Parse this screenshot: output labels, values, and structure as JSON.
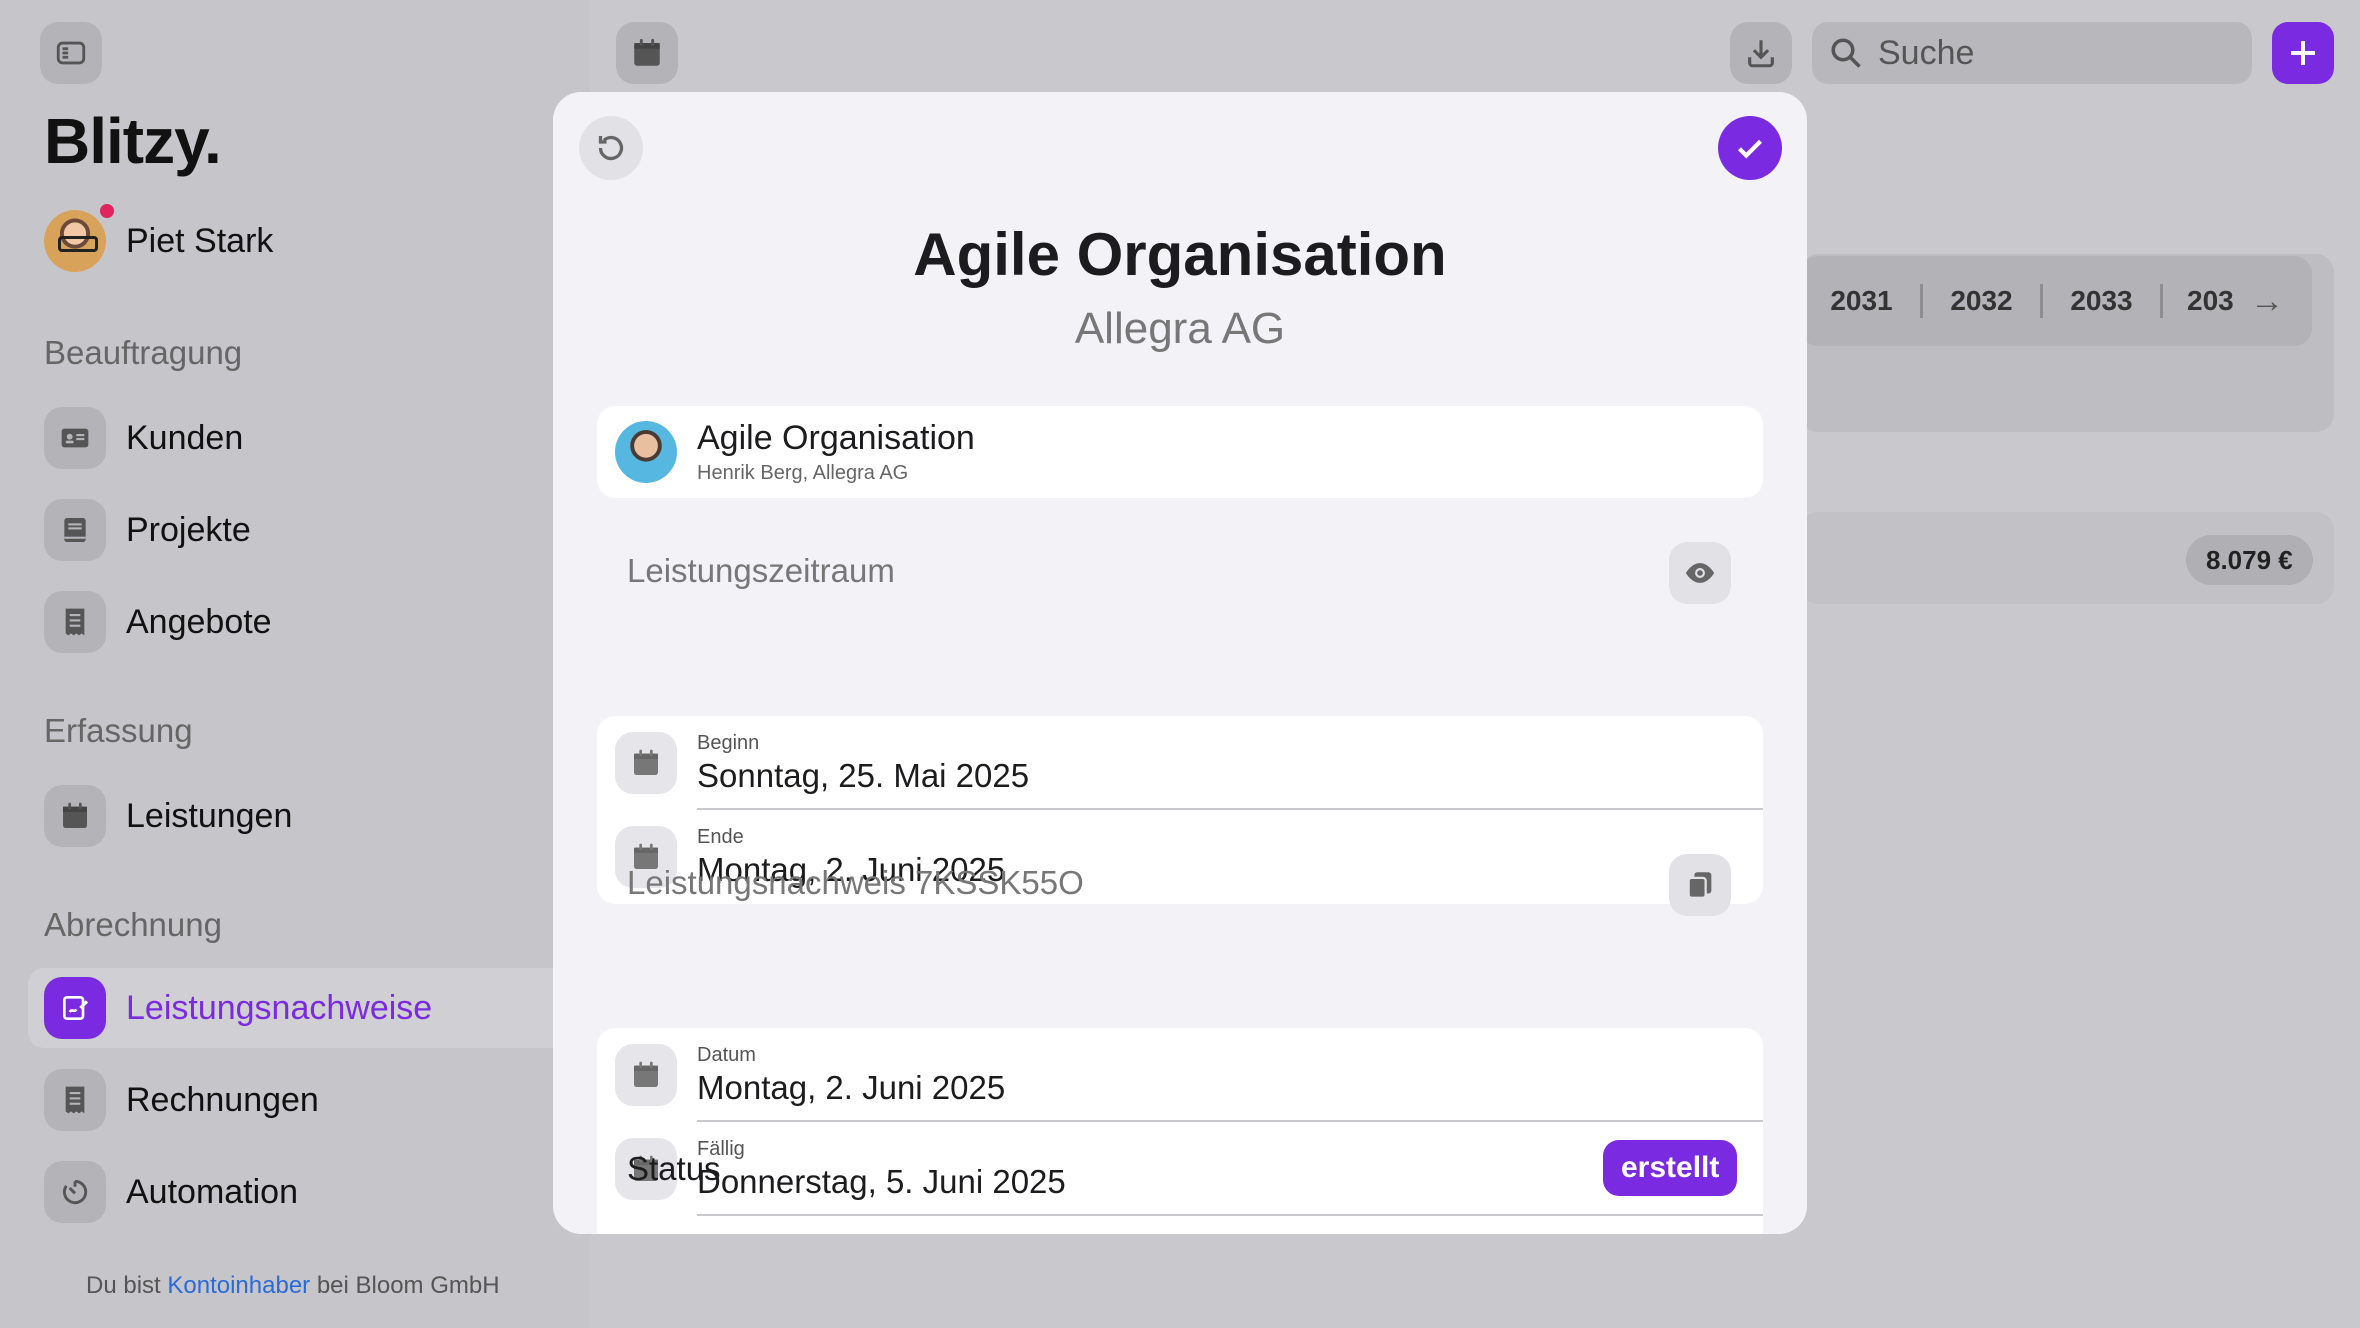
{
  "app": {
    "brand": "Blitzy."
  },
  "user": {
    "name": "Piet Stark"
  },
  "sidebar": {
    "sections": [
      {
        "title": "Beauftragung",
        "items": [
          {
            "label": "Kunden",
            "icon": "contact-card-icon"
          },
          {
            "label": "Projekte",
            "icon": "book-icon"
          },
          {
            "label": "Angebote",
            "icon": "receipt-icon"
          }
        ]
      },
      {
        "title": "Erfassung",
        "items": [
          {
            "label": "Leistungen",
            "icon": "calendar-icon"
          }
        ]
      },
      {
        "title": "Abrechnung",
        "items": [
          {
            "label": "Leistungsnachweise",
            "icon": "signature-icon",
            "active": true
          },
          {
            "label": "Rechnungen",
            "icon": "receipt-icon"
          },
          {
            "label": "Automation",
            "icon": "timer-icon"
          }
        ]
      }
    ],
    "footer": {
      "prefix": "Du bist ",
      "role": "Kontoinhaber",
      "suffix": " bei Bloom GmbH"
    }
  },
  "topbar": {
    "search_placeholder": "Suche"
  },
  "background": {
    "years": [
      "2031",
      "2032",
      "2033",
      "203"
    ],
    "amount": "8.079 €"
  },
  "modal": {
    "title": "Agile Organisation",
    "subtitle": "Allegra AG",
    "project": {
      "name": "Agile Organisation",
      "sub": "Henrik Berg, Allegra AG"
    },
    "period": {
      "heading": "Leistungszeitraum",
      "begin_label": "Beginn",
      "begin_value": "Sonntag, 25. Mai 2025",
      "end_label": "Ende",
      "end_value": "Montag, 2. Juni 2025"
    },
    "proof": {
      "heading": "Leistungsnachweis 7KSSK55O",
      "date_label": "Datum",
      "date_value": "Montag, 2. Juni 2025",
      "due_label": "Fällig",
      "due_value": "Donnerstag, 5. Juni 2025",
      "status_label": "Status",
      "status_value": "erstellt"
    }
  },
  "colors": {
    "accent": "#7a2ae0",
    "link": "#2a6ad9",
    "notification": "#e0245e"
  }
}
